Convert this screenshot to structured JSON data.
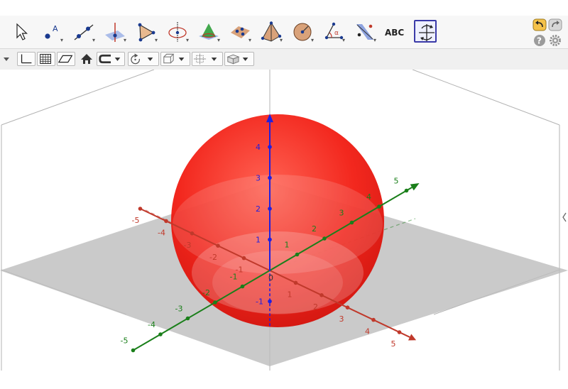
{
  "toolbar": {
    "tools": [
      {
        "name": "move-tool",
        "icon": "pointer-arrow-icon"
      },
      {
        "name": "point-tool",
        "icon": "point-a-icon",
        "label": "A"
      },
      {
        "name": "line-tool",
        "icon": "line-through-points-icon"
      },
      {
        "name": "perpendicular-line-tool",
        "icon": "perpendicular-line-icon"
      },
      {
        "name": "polygon-tool",
        "icon": "polygon-icon"
      },
      {
        "name": "circle-axis-tool",
        "icon": "circle-around-axis-icon"
      },
      {
        "name": "intersect-surfaces-tool",
        "icon": "intersect-surfaces-icon"
      },
      {
        "name": "plane-through-points-tool",
        "icon": "plane-points-icon"
      },
      {
        "name": "pyramid-tool",
        "icon": "pyramid-icon"
      },
      {
        "name": "sphere-tool",
        "icon": "sphere-center-point-icon"
      },
      {
        "name": "angle-tool",
        "icon": "angle-icon",
        "label": "α"
      },
      {
        "name": "reflect-tool",
        "icon": "reflect-plane-icon"
      },
      {
        "name": "text-tool",
        "icon": "text-abc-icon",
        "label": "ABC"
      },
      {
        "name": "rotate-view-tool",
        "icon": "rotate-3d-view-icon"
      }
    ],
    "undo_icon": "undo-icon",
    "redo_icon": "redo-icon",
    "help_icon": "help-icon",
    "help_label": "?",
    "settings_icon": "gear-icon"
  },
  "style_bar": {
    "toggle_icon": "style-bar-toggle-icon",
    "buttons": [
      "axes-toggle-icon",
      "grid-toggle-icon",
      "plane-toggle-icon",
      "home-icon",
      "clipping-icon",
      "rotation-icon",
      "view-direction-icon",
      "projection-icon",
      "view-cube-icon"
    ]
  },
  "colors": {
    "x_axis": "#c0392b",
    "y_axis": "#1a7f1a",
    "z_axis": "#1f1fe0",
    "sphere": "#ee1111",
    "plane": "#bdbdbd"
  },
  "axes": {
    "x_ticks": [
      "-5",
      "-4",
      "-3",
      "-2",
      "-1",
      "0",
      "1",
      "2",
      "3",
      "4",
      "5"
    ],
    "y_ticks": [
      "-5",
      "-4",
      "-3",
      "-2",
      "-1",
      "0",
      "1",
      "2",
      "3",
      "4",
      "5"
    ],
    "z_ticks": [
      "-1",
      "1",
      "2",
      "3",
      "4"
    ],
    "origin_label": "0"
  }
}
